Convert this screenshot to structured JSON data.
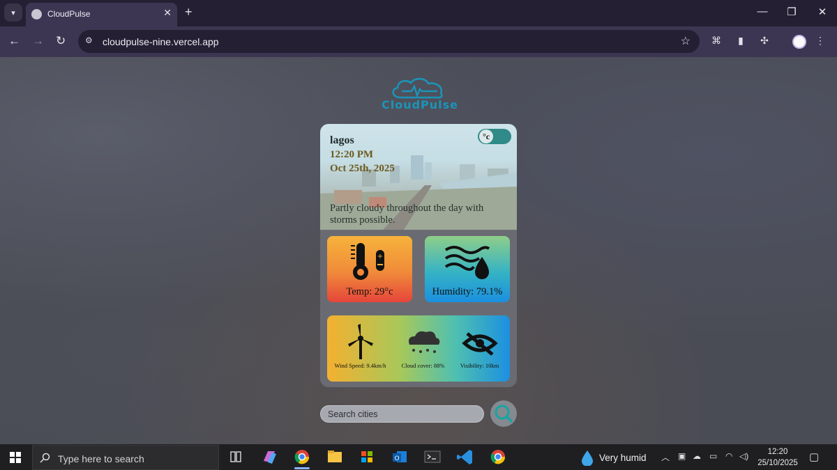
{
  "browser": {
    "tab_title": "CloudPulse",
    "url": "cloudpulse-nine.vercel.app"
  },
  "app": {
    "logo_text": "CloudPulse",
    "city": "lagos",
    "time": "12:20 PM",
    "date": "Oct 25th, 2025",
    "description": "Partly cloudy throughout the day with storms possible.",
    "unit_toggle": "°c",
    "temp_label": "Temp: 29°c",
    "humidity_label": "Humidity: 79.1%",
    "wind_label": "Wind Speed: 9.4km/h",
    "cloud_label": "Cloud cover: 88%",
    "visibility_label": "Visibility: 10km",
    "search_placeholder": "Search cities"
  },
  "taskbar": {
    "search_placeholder": "Type here to search",
    "weather": "Very humid",
    "time": "12:20",
    "date": "25/10/2025"
  },
  "colors": {
    "accent": "#1b94b8",
    "toggle": "#2f8a88",
    "browser_frame": "#241f33"
  }
}
